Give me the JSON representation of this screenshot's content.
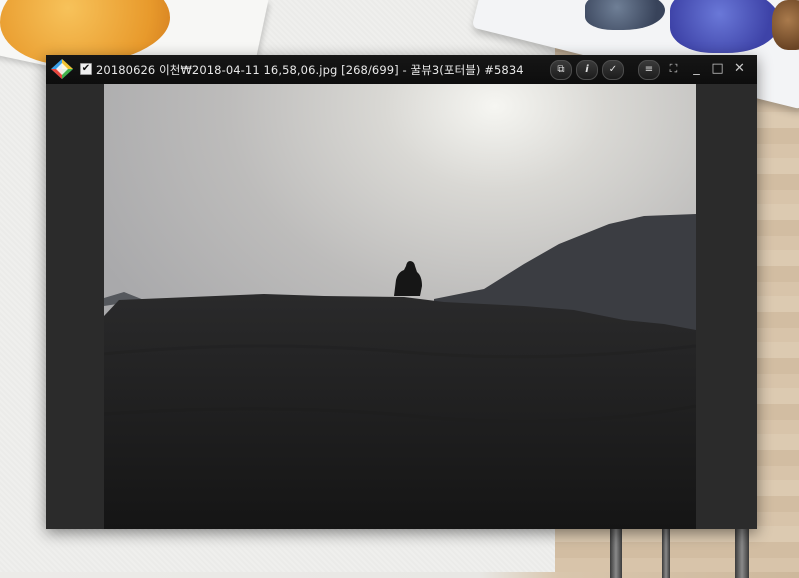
{
  "window": {
    "checkbox_mark": "✔",
    "title": "20180626 이천₩2018-04-11 16,58,06.jpg [268/699] - 꿀뷰3(포터블) #5834"
  },
  "toolbar": {
    "buttons": [
      {
        "name": "fit-window-button",
        "glyph": "⧉"
      },
      {
        "name": "info-button",
        "glyph": "i"
      },
      {
        "name": "select-button",
        "glyph": "✓"
      },
      {
        "name": "menu-button",
        "glyph": "≡"
      },
      {
        "name": "fullscreen-button",
        "glyph": "⛶"
      }
    ],
    "window_controls": [
      "_",
      "□",
      "✕"
    ]
  }
}
